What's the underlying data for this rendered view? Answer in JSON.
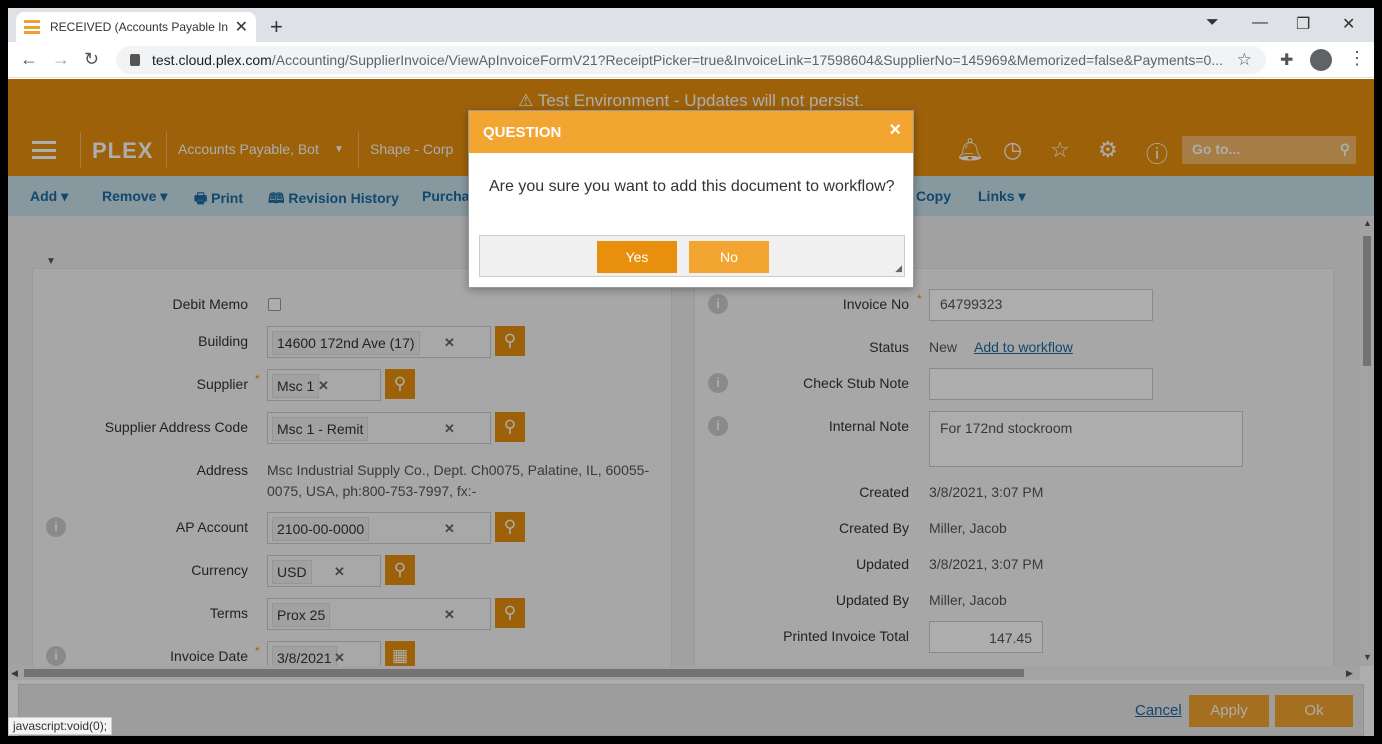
{
  "browser": {
    "tab_title": "RECEIVED (Accounts Payable Invo",
    "new_tab": "+",
    "url_host": "test.cloud.plex.com",
    "url_path": "/Accounting/SupplierInvoice/ViewApInvoiceFormV21?ReceiptPicker=true&InvoiceLink=17598604&SupplierNo=145969&Memorized=false&Payments=0..."
  },
  "banner": {
    "text": "Test Environment - Updates will not persist."
  },
  "nav": {
    "logo": "PLEX",
    "user": "Accounts Payable, Bot",
    "company": "Shape - Corp",
    "goto_placeholder": "Go to..."
  },
  "actions": [
    "Add",
    "Remove",
    "Print",
    "Revision History",
    "Purchase",
    "Copy",
    "Links"
  ],
  "form_left": {
    "debit_memo_label": "Debit Memo",
    "building_label": "Building",
    "building_value": "14600 172nd Ave (17)",
    "supplier_label": "Supplier",
    "supplier_value": "Msc 1",
    "supplier_address_code_label": "Supplier Address Code",
    "supplier_address_code_value": "Msc 1 - Remit",
    "address_label": "Address",
    "address_line1": "Msc Industrial Supply Co., Dept. Ch0075, Palatine, IL, 60055-",
    "address_line2": "0075, USA, ph:800-753-7997, fx:-",
    "ap_account_label": "AP Account",
    "ap_account_value": "2100-00-0000",
    "currency_label": "Currency",
    "currency_value": "USD",
    "terms_label": "Terms",
    "terms_value": "Prox 25",
    "invoice_date_label": "Invoice Date",
    "invoice_date_value": "3/8/2021"
  },
  "form_right": {
    "invoice_no_label": "Invoice No",
    "invoice_no_value": "64799323",
    "status_label": "Status",
    "status_value": "New",
    "add_to_workflow": "Add to workflow",
    "check_stub_note_label": "Check Stub Note",
    "check_stub_note_value": "",
    "internal_note_label": "Internal Note",
    "internal_note_value": "For 172nd stockroom",
    "created_label": "Created",
    "created_value": "3/8/2021, 3:07 PM",
    "created_by_label": "Created By",
    "created_by_value": "Miller, Jacob",
    "updated_label": "Updated",
    "updated_value": "3/8/2021, 3:07 PM",
    "updated_by_label": "Updated By",
    "updated_by_value": "Miller, Jacob",
    "printed_invoice_total_label": "Printed Invoice Total",
    "printed_invoice_total_value": "147.45"
  },
  "footer": {
    "cancel": "Cancel",
    "apply": "Apply",
    "ok": "Ok"
  },
  "statusbar": "javascript:void(0);",
  "dialog": {
    "title": "QUESTION",
    "close": "×",
    "message": "Are you sure you want to add this document to workflow?",
    "yes": "Yes",
    "no": "No"
  },
  "colors": {
    "accent": "#e8900e",
    "dialog_header": "#f2a530",
    "yes_button": "#e8900e",
    "no_button": "#f2a530",
    "action_bar": "#c7e0ea",
    "link": "#1a6aa0"
  }
}
